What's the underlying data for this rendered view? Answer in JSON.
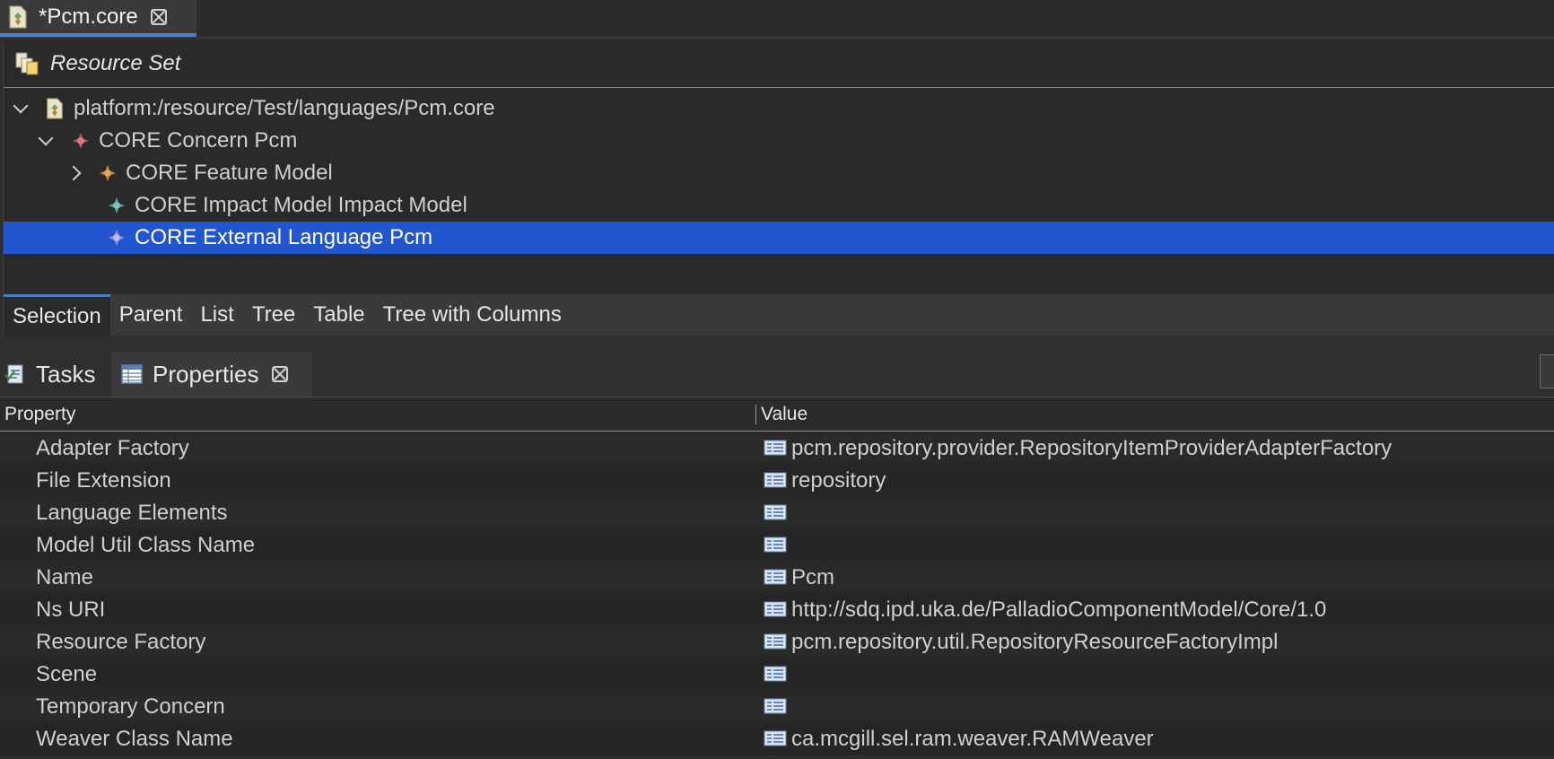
{
  "editor": {
    "tab_label": "*Pcm.core",
    "resource_set_label": "Resource Set",
    "tree": [
      {
        "label": "platform:/resource/Test/languages/Pcm.core",
        "twisty": "open",
        "level": 0,
        "icon": "core-file-icon"
      },
      {
        "label": "CORE Concern Pcm",
        "twisty": "open",
        "level": 1,
        "icon": "core-concern-icon"
      },
      {
        "label": "CORE Feature Model",
        "twisty": "closed",
        "level": 2,
        "icon": "core-feature-model-icon"
      },
      {
        "label": "CORE Impact Model Impact Model",
        "twisty": "none",
        "level": 2,
        "icon": "core-impact-model-icon"
      },
      {
        "label": "CORE External Language Pcm",
        "twisty": "none",
        "level": 2,
        "icon": "core-external-language-icon",
        "selected": true
      }
    ],
    "bottom_tabs": [
      "Selection",
      "Parent",
      "List",
      "Tree",
      "Table",
      "Tree with Columns"
    ],
    "active_bottom_tab": "Selection"
  },
  "views": {
    "tasks_label": "Tasks",
    "properties_label": "Properties"
  },
  "properties": {
    "header_property": "Property",
    "header_value": "Value",
    "rows": [
      {
        "name": "Adapter Factory",
        "value": "pcm.repository.provider.RepositoryItemProviderAdapterFactory"
      },
      {
        "name": "File Extension",
        "value": "repository"
      },
      {
        "name": "Language Elements",
        "value": ""
      },
      {
        "name": "Model Util Class Name",
        "value": ""
      },
      {
        "name": "Name",
        "value": "Pcm"
      },
      {
        "name": "Ns URI",
        "value": "http://sdq.ipd.uka.de/PalladioComponentModel/Core/1.0"
      },
      {
        "name": "Resource Factory",
        "value": "pcm.repository.util.RepositoryResourceFactoryImpl"
      },
      {
        "name": "Scene",
        "value": ""
      },
      {
        "name": "Temporary Concern",
        "value": ""
      },
      {
        "name": "Weaver Class Name",
        "value": "ca.mcgill.sel.ram.weaver.RAMWeaver"
      }
    ]
  },
  "colors": {
    "selection": "#2156cf",
    "accent": "#4a7fc1"
  }
}
